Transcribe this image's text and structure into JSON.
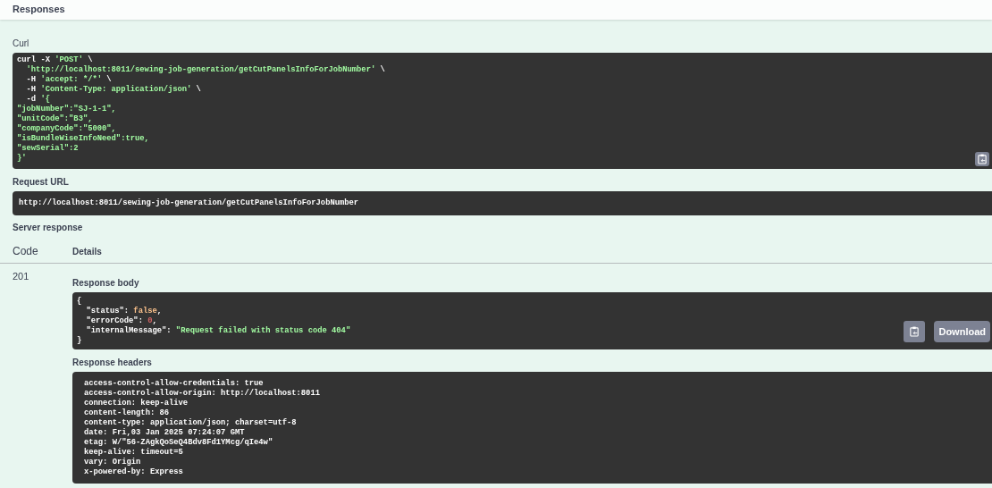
{
  "header": {
    "title": "Responses"
  },
  "curl": {
    "label": "Curl",
    "lines": [
      [
        {
          "text": "curl -X ",
          "kind": "plain"
        },
        {
          "text": "'POST'",
          "kind": "string"
        },
        {
          "text": " \\",
          "kind": "plain"
        }
      ],
      [
        {
          "text": "  'http://localhost:8011/sewing-job-generation/getCutPanelsInfoForJobNumber'",
          "kind": "string"
        },
        {
          "text": " \\",
          "kind": "plain"
        }
      ],
      [
        {
          "text": "  -H ",
          "kind": "plain"
        },
        {
          "text": "'accept: */*'",
          "kind": "string"
        },
        {
          "text": " \\",
          "kind": "plain"
        }
      ],
      [
        {
          "text": "  -H ",
          "kind": "plain"
        },
        {
          "text": "'Content-Type: application/json'",
          "kind": "string"
        },
        {
          "text": " \\",
          "kind": "plain"
        }
      ],
      [
        {
          "text": "  -d ",
          "kind": "plain"
        },
        {
          "text": "'{",
          "kind": "string"
        }
      ],
      [
        {
          "text": "\"jobNumber\":\"SJ-1-1\",",
          "kind": "string"
        }
      ],
      [
        {
          "text": "\"unitCode\":\"B3\",",
          "kind": "string"
        }
      ],
      [
        {
          "text": "\"companyCode\":\"5000\",",
          "kind": "string"
        }
      ],
      [
        {
          "text": "\"isBundleWiseInfoNeed\":true,",
          "kind": "string"
        }
      ],
      [
        {
          "text": "\"sewSerial\":2",
          "kind": "string"
        }
      ],
      [
        {
          "text": "}'",
          "kind": "string"
        }
      ]
    ]
  },
  "request_url": {
    "label": "Request URL",
    "value": "http://localhost:8011/sewing-job-generation/getCutPanelsInfoForJobNumber"
  },
  "server_response": {
    "label": "Server response",
    "columns": [
      "Code",
      "Details"
    ],
    "rows": [
      {
        "code": "201",
        "body_label": "Response body",
        "body_lines": [
          [
            {
              "text": "{",
              "kind": "plain"
            }
          ],
          [
            {
              "text": "  \"status\": ",
              "kind": "plain"
            },
            {
              "text": "false",
              "kind": "literal"
            },
            {
              "text": ",",
              "kind": "plain"
            }
          ],
          [
            {
              "text": "  \"errorCode\": ",
              "kind": "plain"
            },
            {
              "text": "0",
              "kind": "number"
            },
            {
              "text": ",",
              "kind": "plain"
            }
          ],
          [
            {
              "text": "  \"internalMessage\": ",
              "kind": "plain"
            },
            {
              "text": "\"Request failed with status code 404\"",
              "kind": "string"
            }
          ],
          [
            {
              "text": "}",
              "kind": "plain"
            }
          ]
        ],
        "download_button": "Download",
        "headers_label": "Response headers",
        "headers": [
          "access-control-allow-credentials: true",
          "access-control-allow-origin: http://localhost:8011",
          "connection: keep-alive",
          "content-length: 86",
          "content-type: application/json; charset=utf-8",
          "date: Fri,03 Jan 2025 07:24:07 GMT",
          "etag: W/\"56-ZAgkQoSeQ4Bdv8Fd1YMcg/qIe4w\"",
          "keep-alive: timeout=5",
          "vary: Origin",
          "x-powered-by: Express"
        ]
      }
    ]
  }
}
